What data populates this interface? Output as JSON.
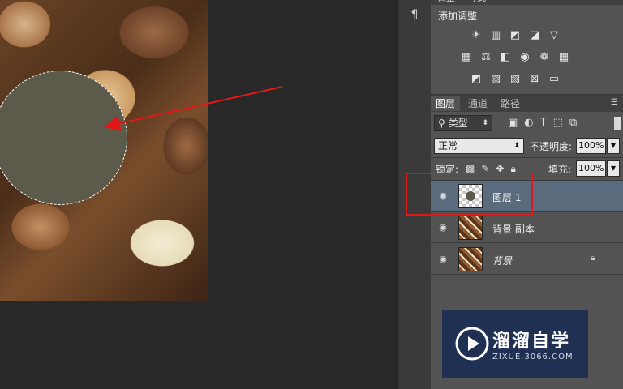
{
  "adjustments": {
    "tab_labels": [
      "调整",
      "样式"
    ],
    "title": "添加调整",
    "row1": [
      "brightness-icon",
      "levels-icon",
      "curves-icon",
      "exposure-icon",
      "vibrance-icon"
    ],
    "row2": [
      "hue-saturation-icon",
      "color-balance-icon",
      "black-white-icon",
      "photo-filter-icon",
      "channel-mixer-icon",
      "color-lookup-icon"
    ],
    "row3": [
      "invert-icon",
      "posterize-icon",
      "threshold-icon",
      "selective-color-icon",
      "gradient-map-icon"
    ]
  },
  "layers_panel": {
    "tabs": [
      "图层",
      "通道",
      "路径"
    ],
    "active_tab": "图层",
    "filter_kind": "类型",
    "blend_mode": "正常",
    "opacity_label": "不透明度:",
    "opacity_value": "100%",
    "lock_label": "锁定:",
    "fill_label": "填充:",
    "fill_value": "100%",
    "layers": [
      {
        "name": "图层 1",
        "selected": true
      },
      {
        "name": "背景 副本",
        "selected": false
      },
      {
        "name": "背景",
        "selected": false,
        "locked": true
      }
    ]
  },
  "watermark": {
    "title": "溜溜自学",
    "subtitle": "ZIXUE.3066.COM"
  },
  "colors": {
    "circle_fill": "#5c5a4a",
    "highlight_red": "#e01818",
    "selected_layer": "#5b6b7e"
  }
}
